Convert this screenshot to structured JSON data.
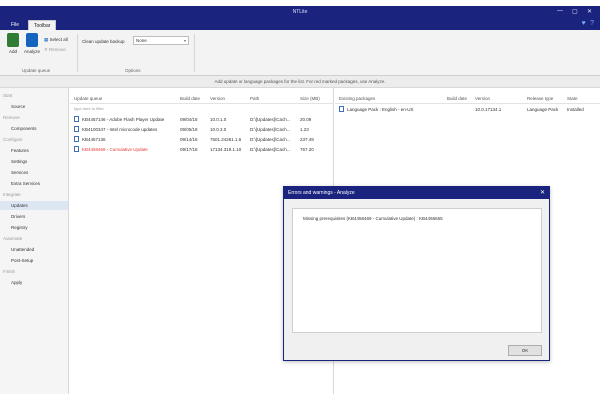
{
  "window": {
    "title": "NTLite",
    "controls": [
      "—",
      "▢",
      "✕"
    ]
  },
  "tabs": [
    {
      "label": "File",
      "active": false
    },
    {
      "label": "Toolbar",
      "active": true
    }
  ],
  "ribbon": {
    "add_label": "Add",
    "analyze_label": "Analyze",
    "select_all_label": "Select all",
    "remove_label": "Remove",
    "update_queue_group": "Update queue",
    "backup_label": "Clean update backup",
    "backup_value": "None",
    "options_group": "Options"
  },
  "infobar": {
    "text": "Add update or language packages for the list. For red marked packages, use Analyze."
  },
  "sidebar": {
    "groups": [
      {
        "label": "Start",
        "items": [
          {
            "label": "Source",
            "active": false
          }
        ]
      },
      {
        "label": "Remove",
        "items": [
          {
            "label": "Components",
            "active": false
          }
        ]
      },
      {
        "label": "Configure",
        "items": [
          {
            "label": "Features",
            "active": false
          },
          {
            "label": "Settings",
            "active": false
          },
          {
            "label": "Services",
            "active": false
          },
          {
            "label": "Extra Services",
            "active": false
          }
        ]
      },
      {
        "label": "Integrate",
        "items": [
          {
            "label": "Updates",
            "active": true
          },
          {
            "label": "Drivers",
            "active": false
          },
          {
            "label": "Registry",
            "active": false
          }
        ]
      },
      {
        "label": "Automate",
        "items": [
          {
            "label": "Unattended",
            "active": false
          },
          {
            "label": "Post-Setup",
            "active": false
          }
        ]
      },
      {
        "label": "Finish",
        "items": [
          {
            "label": "Apply",
            "active": false
          }
        ]
      }
    ]
  },
  "queue": {
    "headers": [
      "Update queue",
      "Build date",
      "Version",
      "Path",
      "Size (MB)"
    ],
    "filter_placeholder": "type here to filter",
    "rows": [
      {
        "name": "KB4457146 - Adobe Flash Player Update",
        "date": "09/04/18",
        "version": "10.0.1.0",
        "path": "D:\\[Updates]\\Cach...",
        "size": "20.09",
        "red": false
      },
      {
        "name": "KB4100347 - Intel microcode updates",
        "date": "09/05/18",
        "version": "10.0.3.0",
        "path": "D:\\[Updates]\\Cach...",
        "size": "1.23",
        "red": false
      },
      {
        "name": "KB4457136",
        "date": "09/14/18",
        "version": "7601.24261.1.6",
        "path": "D:\\[Updates]\\Cach...",
        "size": "237.49",
        "red": false
      },
      {
        "name": "KB4458469 - Cumulative Update",
        "date": "09/17/18",
        "version": "17134.319.1.10",
        "path": "D:\\[Updates]\\Cach...",
        "size": "767.20",
        "red": true
      }
    ]
  },
  "existing": {
    "headers": [
      "Existing packages",
      "Build date",
      "Version",
      "Release type",
      "State"
    ],
    "rows": [
      {
        "name": "Language Pack : English - en-US",
        "date": "",
        "version": "10.0.17134.1",
        "release": "Language Pack",
        "state": "Installed"
      }
    ]
  },
  "dialog": {
    "title": "Errors and warnings - Analyze",
    "message": "Missing prerequisites (KB4458469 - Cumulative Update) : KB4456655",
    "ok_label": "OK"
  },
  "colors": {
    "accent": "#1a237e",
    "error_text": "#e53935",
    "selection": "#dde6f3"
  }
}
